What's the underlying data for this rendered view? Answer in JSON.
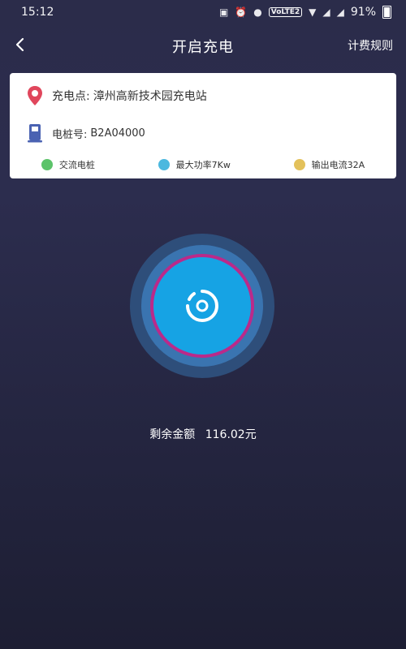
{
  "status_bar": {
    "time": "15:12",
    "network_badge": "VoLTE2",
    "battery": "91%"
  },
  "header": {
    "title": "开启充电",
    "right_action": "计费规则"
  },
  "info_card": {
    "station_label": "充电点:",
    "station_value": "漳州高新技术园充电站",
    "pile_label": "电桩号:",
    "pile_value": "B2A04000",
    "tags": [
      {
        "label": "交流电桩",
        "color": "#5cc36a"
      },
      {
        "label": "最大功率7Kw",
        "color": "#4bb8df"
      },
      {
        "label": "输出电流32A",
        "color": "#e3c15b"
      }
    ]
  },
  "charge_button": {
    "icon": "charge-start-icon"
  },
  "balance": {
    "label": "剩余金额",
    "amount": "116.02元"
  },
  "colors": {
    "accent": "#16a3e4",
    "ring_highlight": "#ba2a8a",
    "location_pin": "#e0465c",
    "pile_icon": "#4a62b2"
  }
}
